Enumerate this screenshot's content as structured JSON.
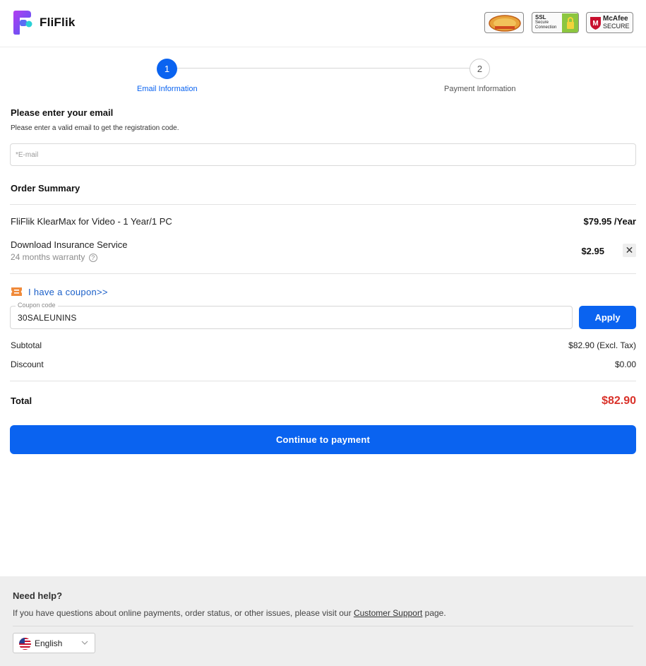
{
  "header": {
    "logo_text": "FliFlik",
    "badges": {
      "ssl_title": "SSL",
      "ssl_line1": "Secure",
      "ssl_line2": "Connection",
      "mcafee_brand": "McAfee",
      "mcafee_label": "SECURE"
    }
  },
  "steps": [
    {
      "number": "1",
      "label": "Email Information",
      "active": true
    },
    {
      "number": "2",
      "label": "Payment Information",
      "active": false
    }
  ],
  "email": {
    "title": "Please enter your email",
    "hint": "Please enter a valid email to get the registration code.",
    "placeholder": "*E-mail",
    "value": ""
  },
  "order": {
    "title": "Order Summary",
    "product_name": "FliFlik KlearMax for Video - 1 Year/1 PC",
    "product_price": "$79.95 /Year",
    "insurance_name": "Download Insurance Service",
    "insurance_note": "24 months warranty",
    "insurance_price": "$2.95",
    "remove_glyph": "✕"
  },
  "coupon": {
    "link_text": "I have a coupon>>",
    "field_label": "Coupon code",
    "field_value": "30SALEUNINS",
    "apply_label": "Apply"
  },
  "totals": {
    "subtotal_label": "Subtotal",
    "subtotal_value": "$82.90 (Excl. Tax)",
    "discount_label": "Discount",
    "discount_value": "$0.00",
    "total_label": "Total",
    "total_value": "$82.90"
  },
  "continue_label": "Continue to payment",
  "footer": {
    "help_title": "Need help?",
    "help_text_before": "If you have questions about online payments, order status, or other issues, please visit our ",
    "help_link": "Customer Support",
    "help_text_after": " page.",
    "language": "English"
  },
  "colors": {
    "accent": "#0a63f0",
    "total": "#d9322a",
    "coupon_icon": "#f08a3a",
    "logo_purple": "#7b3cf2",
    "logo_teal": "#2ad0d6"
  },
  "icons": {
    "help": "question-circle-icon",
    "remove": "close-icon",
    "coupon": "ticket-icon",
    "language_flag": "us-flag-icon",
    "dropdown": "chevron-down-icon"
  }
}
